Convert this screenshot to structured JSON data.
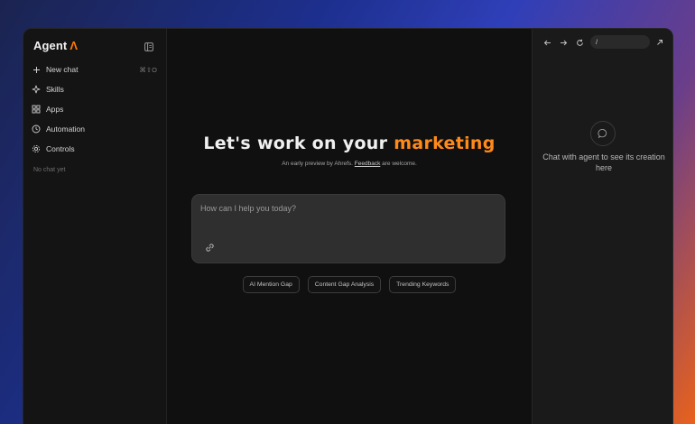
{
  "brand": {
    "name": "Agent",
    "mark": "Λ",
    "accent_color": "#ff7a00"
  },
  "sidebar": {
    "items": [
      {
        "label": "New chat",
        "icon": "plus-icon",
        "shortcut": "⌘⇧O"
      },
      {
        "label": "Skills",
        "icon": "sparkle-icon"
      },
      {
        "label": "Apps",
        "icon": "grid-icon"
      },
      {
        "label": "Automation",
        "icon": "clock-icon"
      },
      {
        "label": "Controls",
        "icon": "gear-icon"
      }
    ],
    "empty_text": "No chat yet"
  },
  "main": {
    "headline_prefix": "Let's work on your ",
    "headline_highlight": "marketing",
    "sub_prefix": "An early preview by Ahrefs. ",
    "sub_link": "Feedback",
    "sub_suffix": " are welcome.",
    "prompt_placeholder": "How can I help you today?",
    "suggestions": [
      "AI Mention Gap",
      "Content Gap Analysis",
      "Trending Keywords"
    ]
  },
  "browser": {
    "url": "/",
    "message": "Chat with agent to see its creation here"
  }
}
